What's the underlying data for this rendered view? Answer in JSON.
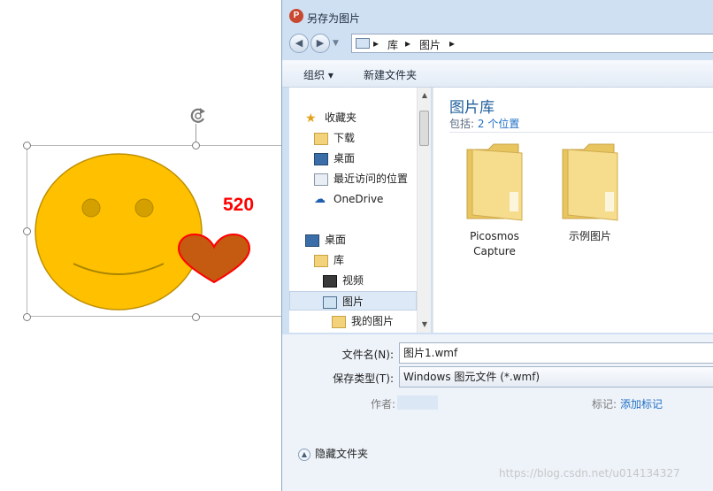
{
  "slide": {
    "label_520": "520"
  },
  "dialog": {
    "app_icon_letter": "P",
    "title": "另存为图片",
    "address": [
      "库",
      "图片"
    ],
    "toolbar": {
      "organize": "组织 ▾",
      "new_folder": "新建文件夹"
    },
    "nav_items": [
      {
        "label": "收藏夹",
        "icon": "star-icon"
      },
      {
        "label": "下载",
        "icon": "download-folder-icon"
      },
      {
        "label": "桌面",
        "icon": "desktop-icon"
      },
      {
        "label": "最近访问的位置",
        "icon": "recent-places-icon"
      },
      {
        "label": "OneDrive",
        "icon": "cloud-icon"
      },
      {
        "label": "桌面",
        "icon": "desktop-icon"
      },
      {
        "label": "库",
        "icon": "library-icon"
      },
      {
        "label": "视频",
        "icon": "video-icon"
      },
      {
        "label": "图片",
        "icon": "pictures-icon",
        "selected": true
      },
      {
        "label": "我的图片",
        "icon": "folder-icon"
      }
    ],
    "library": {
      "title": "图片库",
      "includes_label": "包括:",
      "includes_link": "2 个位置",
      "folders": [
        {
          "line1": "Picosmos",
          "line2": "Capture"
        },
        {
          "line1": "示例图片",
          "line2": ""
        }
      ]
    },
    "file_name_label": "文件名(N):",
    "file_name_value": "图片1.wmf",
    "save_type_label": "保存类型(T):",
    "save_type_value": "Windows 图元文件 (*.wmf)",
    "author_label": "作者:",
    "tags_label": "标记:",
    "tags_link": "添加标记",
    "hide_folders": "隐藏文件夹",
    "colors": {
      "accent": "#1e5f9c",
      "link": "#1f6fc5",
      "chrome": "#cfe0f3"
    }
  },
  "watermark": "https://blog.csdn.net/u014134327"
}
